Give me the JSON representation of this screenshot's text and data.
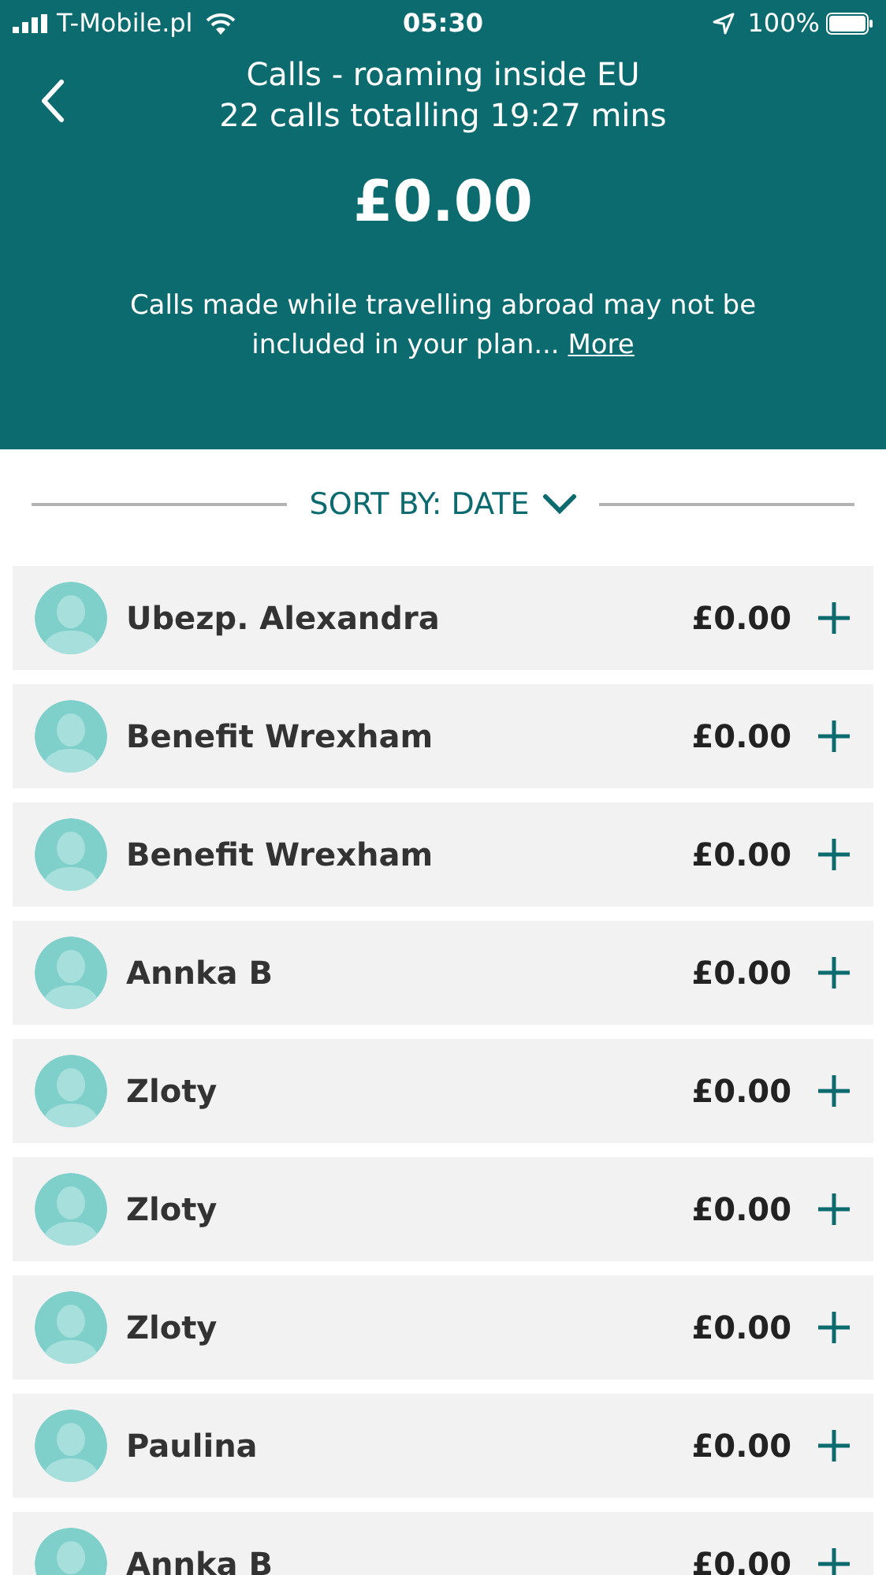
{
  "status_bar": {
    "carrier": "T-Mobile.pl",
    "time": "05:30",
    "battery": "100%"
  },
  "header": {
    "title": "Calls - roaming inside EU",
    "subtitle": "22 calls totalling 19:27 mins",
    "amount": "£0.00",
    "note": "Calls made while travelling abroad may not be included in your plan...",
    "more_link": "More"
  },
  "sort": {
    "label": "SORT BY: DATE"
  },
  "calls": [
    {
      "name": "Ubezp. Alexandra",
      "amount": "£0.00"
    },
    {
      "name": "Benefit Wrexham",
      "amount": "£0.00"
    },
    {
      "name": "Benefit Wrexham",
      "amount": "£0.00"
    },
    {
      "name": "Annka B",
      "amount": "£0.00"
    },
    {
      "name": "Zloty",
      "amount": "£0.00"
    },
    {
      "name": "Zloty",
      "amount": "£0.00"
    },
    {
      "name": "Zloty",
      "amount": "£0.00"
    },
    {
      "name": "Paulina",
      "amount": "£0.00"
    },
    {
      "name": "Annka B",
      "amount": "£0.00"
    }
  ]
}
